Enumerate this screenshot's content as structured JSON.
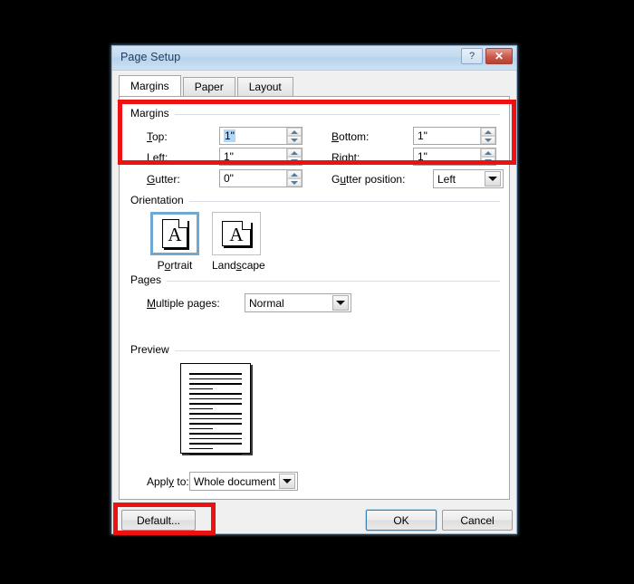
{
  "window": {
    "title": "Page Setup",
    "help_button": "?",
    "close_button": "✕"
  },
  "tabs": [
    {
      "label": "Margins",
      "active": true
    },
    {
      "label": "Paper",
      "active": false
    },
    {
      "label": "Layout",
      "active": false
    }
  ],
  "margins_group": {
    "legend": "Margins",
    "fields": [
      {
        "label": "Top:",
        "value": "1\"",
        "selected": true
      },
      {
        "label": "Bottom:",
        "value": "1\"",
        "selected": false
      },
      {
        "label": "Left:",
        "value": "1\"",
        "selected": false
      },
      {
        "label": "Right:",
        "value": "1\"",
        "selected": false
      }
    ],
    "gutter_label": "Gutter:",
    "gutter_value": "0\"",
    "gutter_position_label": "Gutter position:",
    "gutter_position_value": "Left"
  },
  "orientation_group": {
    "legend": "Orientation",
    "options": [
      {
        "label": "Portrait",
        "glyph": "A",
        "selected": true
      },
      {
        "label": "Landscape",
        "glyph": "A",
        "selected": false
      }
    ]
  },
  "pages_group": {
    "legend": "Pages",
    "multiple_pages_label": "Multiple pages:",
    "multiple_pages_value": "Normal"
  },
  "preview_group": {
    "legend": "Preview"
  },
  "apply_to": {
    "label": "Apply to:",
    "value": "Whole document"
  },
  "footer": {
    "default_button": "Default...",
    "ok_button": "OK",
    "cancel_button": "Cancel"
  },
  "annotations": {
    "color": "#ee1111",
    "boxes": [
      {
        "name": "margins-highlight"
      },
      {
        "name": "default-button-highlight"
      }
    ]
  }
}
